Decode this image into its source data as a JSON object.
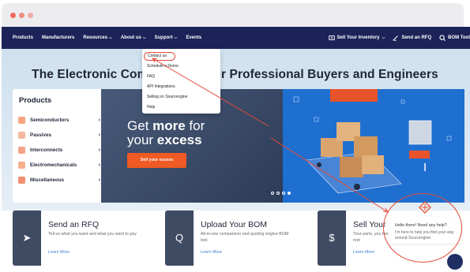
{
  "nav": {
    "items": [
      {
        "label": "Products"
      },
      {
        "label": "Manufacturers"
      },
      {
        "label": "Resources",
        "caret": "⌵"
      },
      {
        "label": "About us",
        "caret": "⌵"
      },
      {
        "label": "Support",
        "caret": "⌵"
      },
      {
        "label": "Events"
      }
    ],
    "right": [
      {
        "label": "Sell Your Inventory",
        "caret": "⌵",
        "icon": "tag-icon"
      },
      {
        "label": "Send an RFQ",
        "icon": "pen-icon"
      },
      {
        "label": "BOM Tool",
        "icon": "search-icon"
      }
    ]
  },
  "support_menu": {
    "items": [
      "Contact us",
      "Schedule a Demo",
      "FAQ",
      "API Integrations",
      "Selling on Sourcengine",
      "Help"
    ]
  },
  "hero": {
    "headline": "The Electronic Compo   nplace for Professional Buyers and Engineers"
  },
  "products": {
    "title": "Products",
    "items": [
      {
        "label": "Semiconductors",
        "icon": "chip-icon"
      },
      {
        "label": "Passives",
        "icon": "resistor-icon"
      },
      {
        "label": "Interconnects",
        "icon": "connector-icon"
      },
      {
        "label": "Electromechanicals",
        "icon": "switch-icon"
      },
      {
        "label": "Miscellaneous",
        "icon": "misc-icon"
      }
    ],
    "chevron": "›"
  },
  "banner": {
    "line1_pre": "Get ",
    "line1_bold": "more",
    "line1_post": " for",
    "line2_pre": "your ",
    "line2_bold": "excess",
    "button": "Sell your excess",
    "slide_count": 4,
    "active_slide": 4
  },
  "cards": [
    {
      "title": "Send an RFQ",
      "desc": "Tell us what you want and what you want to pay",
      "link": "Learn More",
      "icon": "send-icon",
      "glyph": "➤"
    },
    {
      "title": "Upload Your BOM",
      "desc": "All-in-one comparison and quoting engine BOM tool",
      "link": "Learn More",
      "icon": "search-icon",
      "glyph": "Q"
    },
    {
      "title": "Sell Your",
      "desc": "Your parts, you the rest",
      "link": "Learn More",
      "icon": "cpu-icon",
      "glyph": "$"
    }
  ],
  "chat": {
    "greeting": "Hello there! Need any help?",
    "sub": "I'm here to help you find your way around Sourcengine."
  },
  "colors": {
    "nav_bg": "#1c2358",
    "accent": "#f05a24",
    "highlight": "#e34b3a",
    "dot_colors": [
      "#ec6a5e",
      "#f4bf4f",
      "#61c554"
    ]
  }
}
